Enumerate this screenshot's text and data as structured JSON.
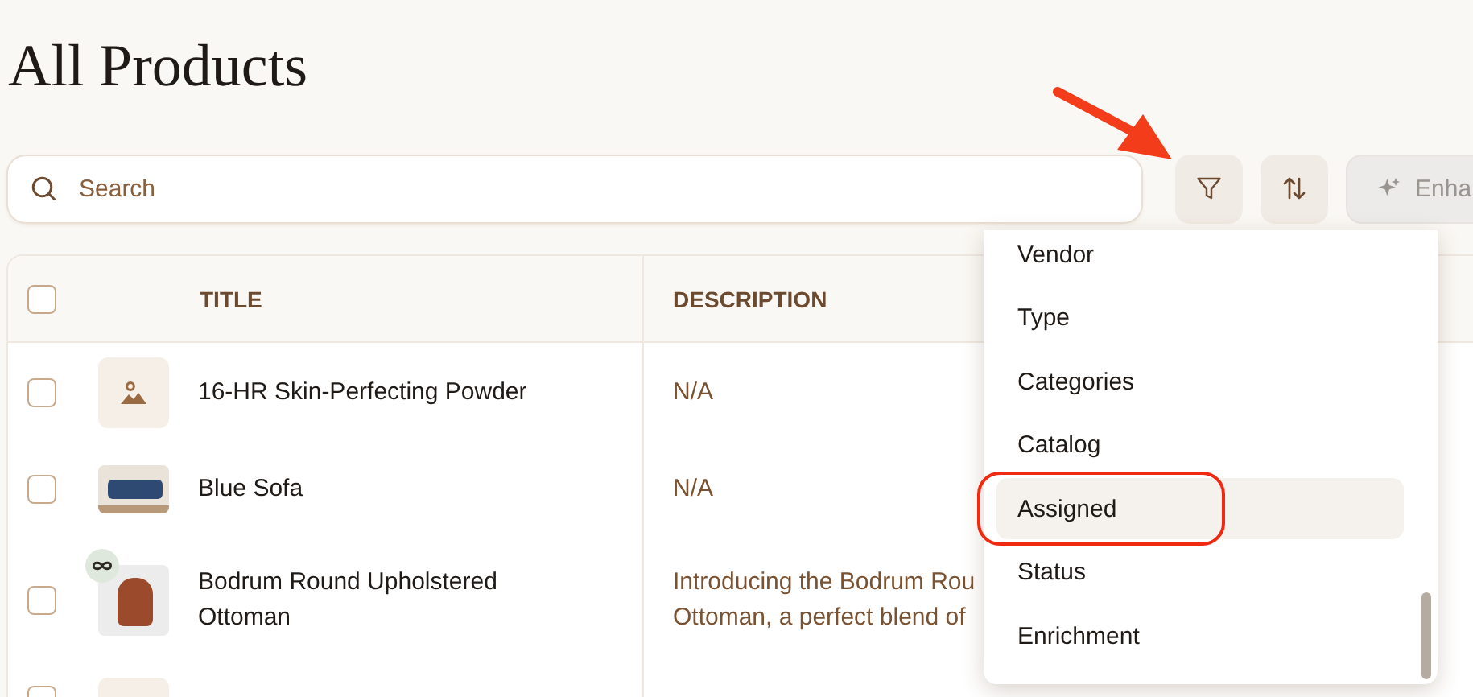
{
  "page": {
    "title": "All Products"
  },
  "search": {
    "placeholder": "Search"
  },
  "toolbar": {
    "enhance": {
      "label": "Enha",
      "disabled": true
    }
  },
  "table": {
    "header_checkbox": {
      "checked": false
    },
    "columns": [
      "TITLE",
      "DESCRIPTION"
    ],
    "rows": [
      {
        "checked": false,
        "kind": "placeholder",
        "badge": false,
        "title": [
          "16-HR Skin-Perfecting Powder"
        ],
        "description": [
          "N/A"
        ]
      },
      {
        "checked": false,
        "kind": "sofa",
        "badge": false,
        "title": [
          "Blue Sofa"
        ],
        "description": [
          "N/A"
        ]
      },
      {
        "checked": false,
        "kind": "ottoman",
        "badge": true,
        "title": [
          "Bodrum Round Upholstered",
          "Ottoman"
        ],
        "description": [
          "Introducing the Bodrum Rou",
          "Ottoman, a perfect blend of"
        ]
      },
      {
        "checked": false,
        "kind": "placeholder",
        "badge": false,
        "title": [],
        "description": []
      }
    ]
  },
  "filter_menu": {
    "items": [
      {
        "label": "Vendor",
        "highlighted": false
      },
      {
        "label": "Type",
        "highlighted": false
      },
      {
        "label": "Categories",
        "highlighted": false
      },
      {
        "label": "Catalog",
        "highlighted": false
      },
      {
        "label": "Assigned",
        "highlighted": true
      },
      {
        "label": "Status",
        "highlighted": false
      },
      {
        "label": "Enrichment",
        "highlighted": false
      }
    ]
  }
}
